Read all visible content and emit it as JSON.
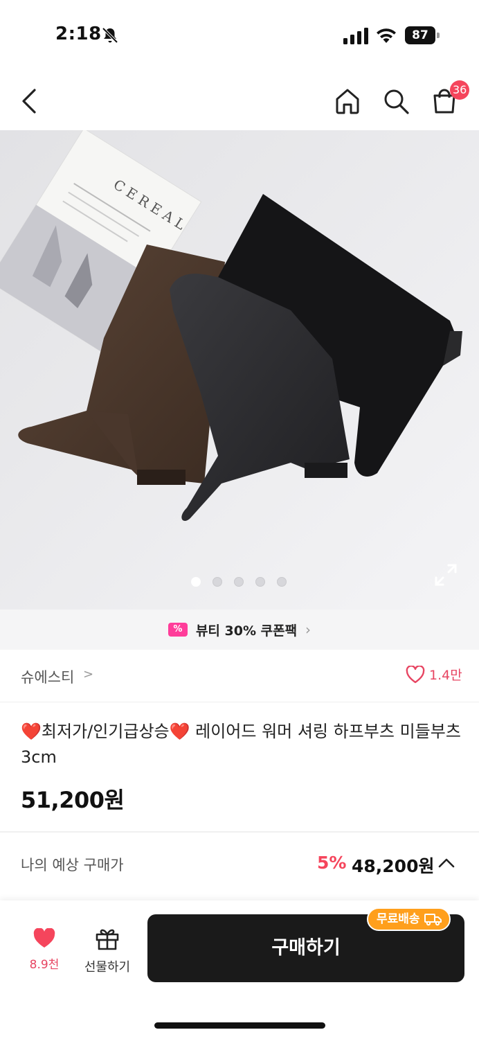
{
  "status_bar": {
    "time": "2:18",
    "battery": "87"
  },
  "nav": {
    "cart_count": "36"
  },
  "gallery": {
    "slide_count": 5,
    "active_index": 0,
    "magazine_brand": "CEREAL"
  },
  "coupon": {
    "label": "뷰티 30% 쿠폰팩",
    "chevron": "›"
  },
  "brand": {
    "name": "슈에스티",
    "chevron": ">",
    "like_count": "1.4만"
  },
  "product": {
    "title": "❤️최저가/인기급상승❤️ 레이어드 워머 셔링 하프부츠 미들부츠 3cm",
    "price": "51,200원"
  },
  "estimate": {
    "label": "나의 예상 구매가",
    "discount": "5%",
    "price": "48,200원"
  },
  "bottom": {
    "wish_count": "8.9천",
    "gift_label": "선물하기",
    "buy_label": "구매하기",
    "free_shipping": "무료배송"
  },
  "colors": {
    "accent_red": "#f5455c",
    "buy_button": "#1a1a1a",
    "shipping_badge": "#ff9f1c",
    "coupon_pink": "#ff3d9a"
  }
}
